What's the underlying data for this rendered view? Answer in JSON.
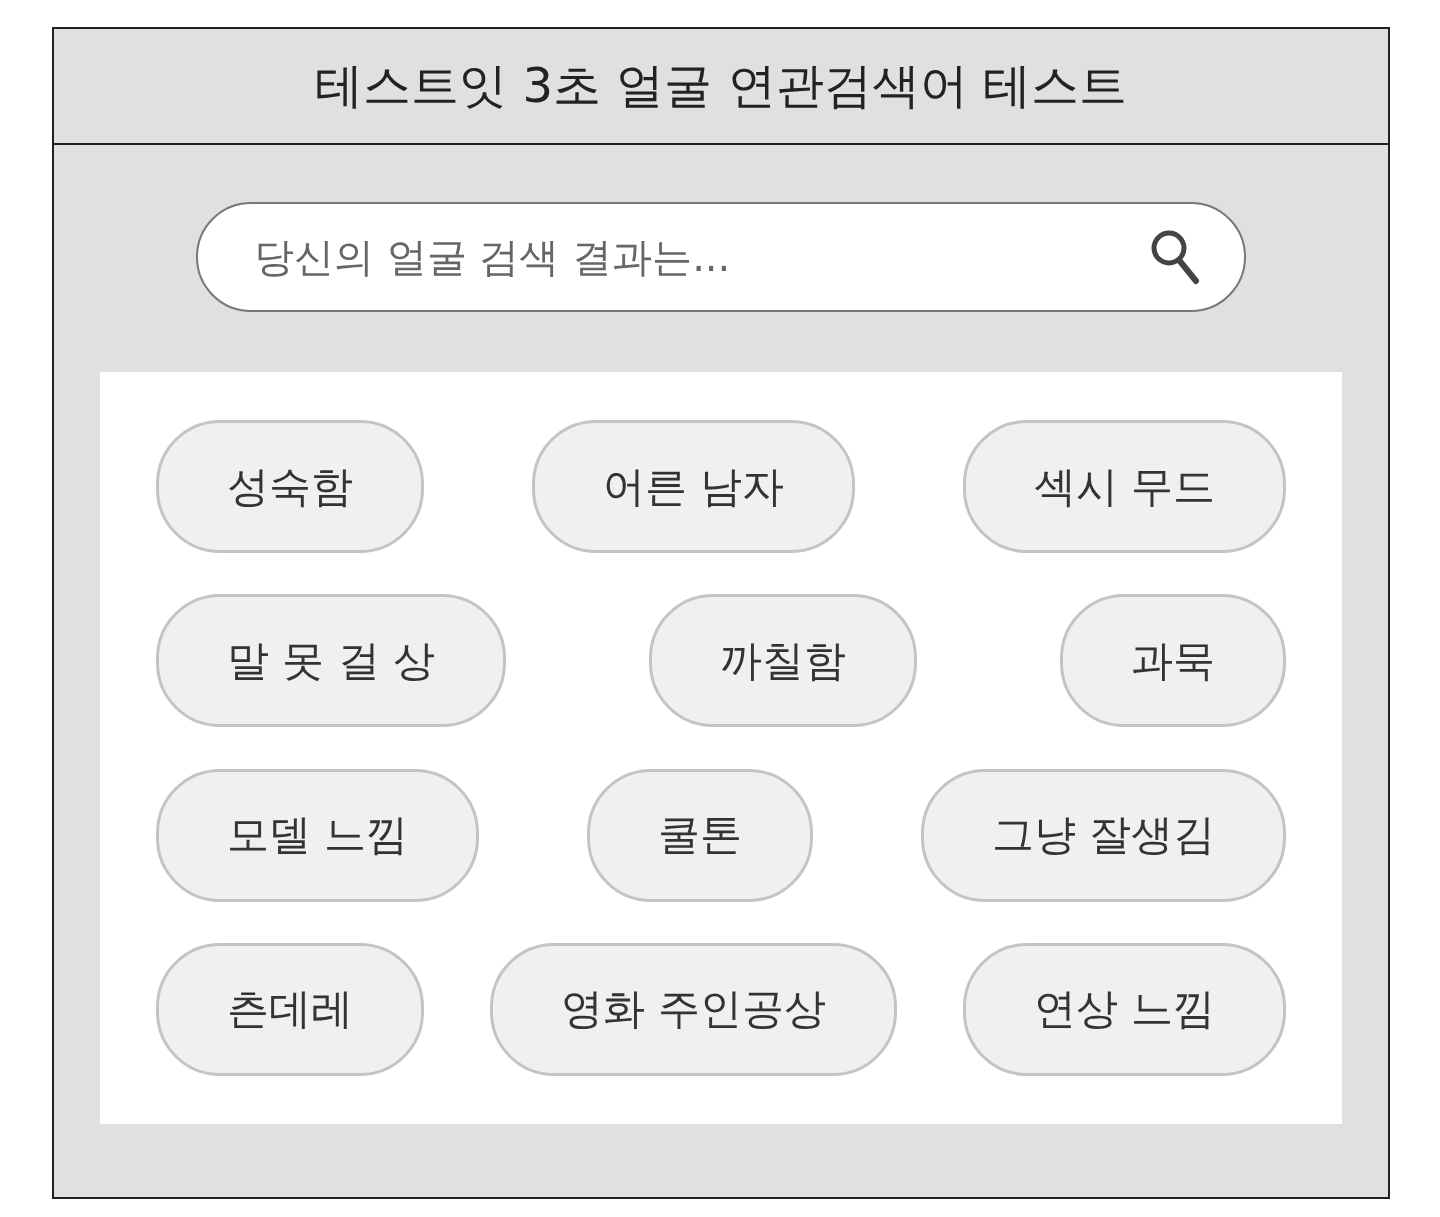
{
  "window": {
    "title": "테스트잇 3초 얼굴 연관검색어 테스트"
  },
  "search": {
    "placeholder": "당신의 얼굴 검색 결과는..."
  },
  "tag_rows": [
    {
      "tags": [
        "성숙함",
        "어른 남자",
        "섹시 무드"
      ]
    },
    {
      "tags": [
        "말 못 걸 상",
        "까칠함",
        "과묵"
      ]
    },
    {
      "tags": [
        "모델 느낌",
        "쿨톤",
        "그냥 잘생김"
      ]
    },
    {
      "tags": [
        "츤데레",
        "영화 주인공상",
        "연상 느낌"
      ]
    }
  ]
}
